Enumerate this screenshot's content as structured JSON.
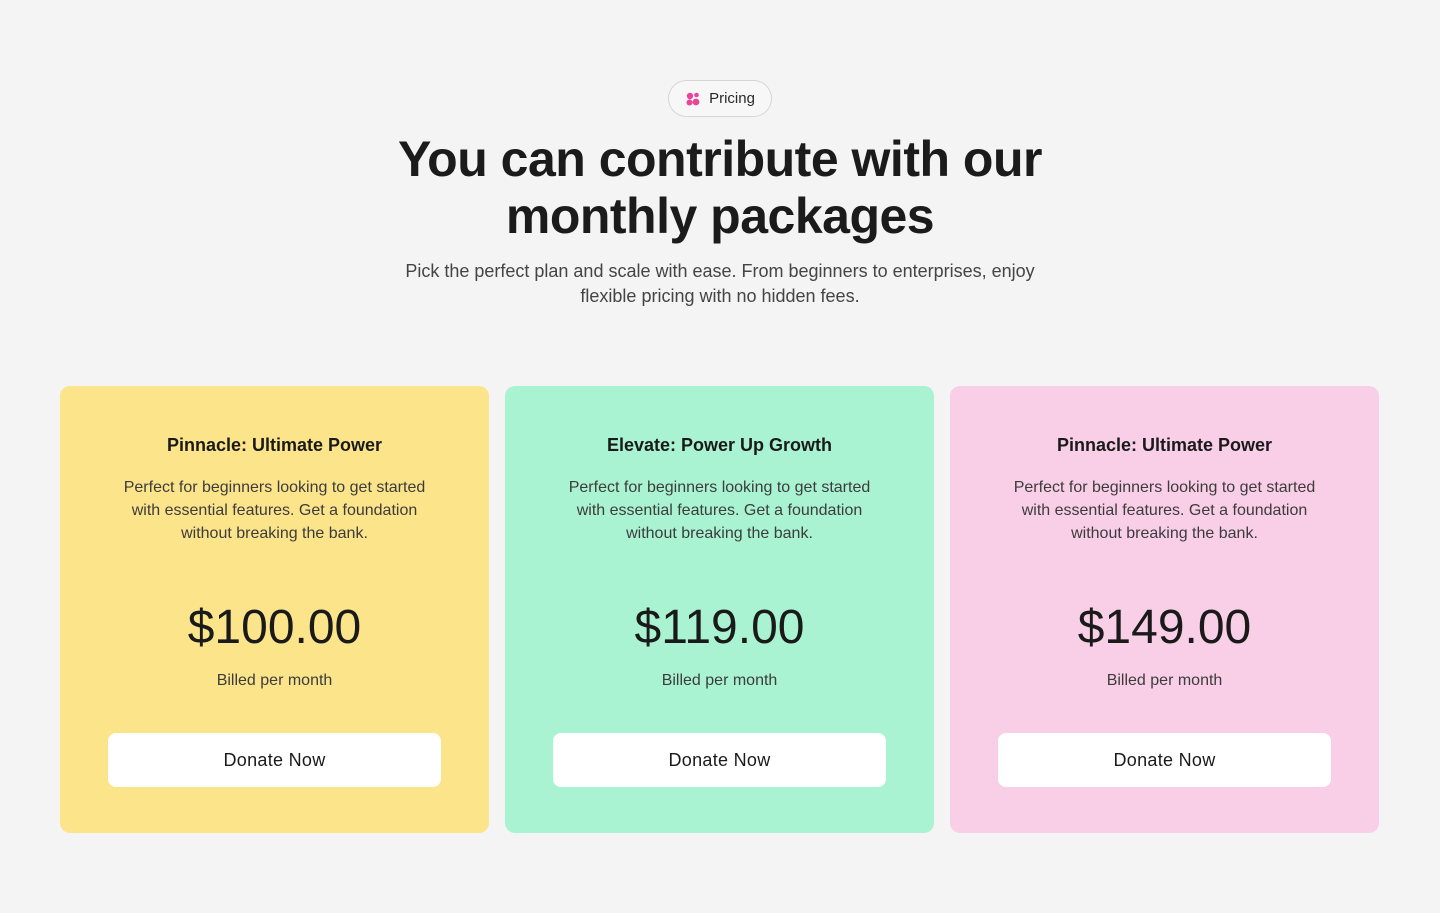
{
  "header": {
    "badge_label": "Pricing",
    "badge_icon": "flower-icon",
    "badge_icon_color": "#e8459a",
    "title": "You can contribute with our monthly packages",
    "subtitle": "Pick the perfect plan and scale with ease. From beginners to enterprises, enjoy flexible pricing with no hidden fees."
  },
  "plans": [
    {
      "title": "Pinnacle: Ultimate Power",
      "description": "Perfect for beginners looking to get started with essential features. Get a foundation without breaking the bank.",
      "price": "$100.00",
      "billing": "Billed per month",
      "button_label": "Donate Now",
      "background": "#fce48a"
    },
    {
      "title": "Elevate: Power Up Growth",
      "description": "Perfect for beginners looking to get started with essential features. Get a foundation without breaking the bank.",
      "price": "$119.00",
      "billing": "Billed per month",
      "button_label": "Donate Now",
      "background": "#a9f3d2"
    },
    {
      "title": "Pinnacle: Ultimate Power",
      "description": "Perfect for beginners looking to get started with essential features. Get a foundation without breaking the bank.",
      "price": "$149.00",
      "billing": "Billed per month",
      "button_label": "Donate Now",
      "background": "#f9cee7"
    }
  ]
}
